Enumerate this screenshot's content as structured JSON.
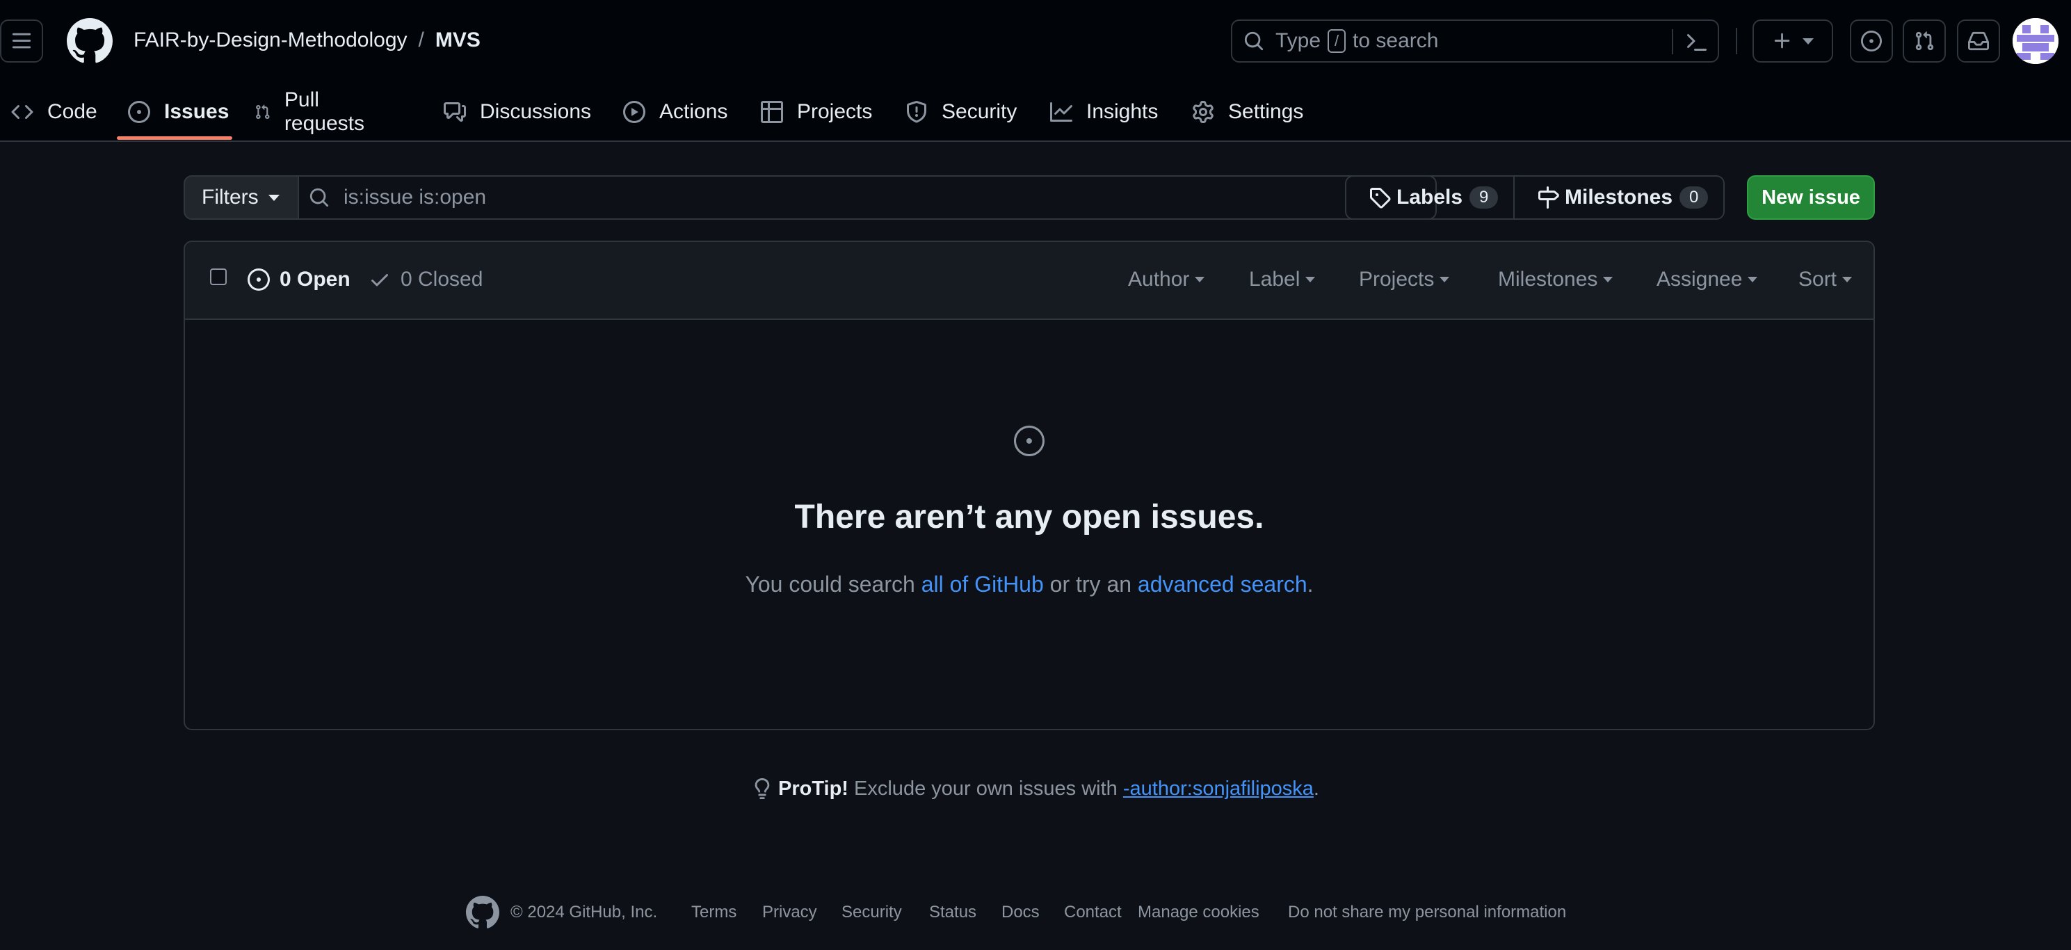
{
  "header": {
    "owner": "FAIR-by-Design-Methodology",
    "separator": "/",
    "repo": "MVS",
    "search_prefix": "Type",
    "search_key": "/",
    "search_suffix": "to search"
  },
  "nav": {
    "tabs": [
      {
        "label": "Code",
        "icon": "code-icon"
      },
      {
        "label": "Issues",
        "icon": "issue-opened-icon",
        "active": true
      },
      {
        "label": "Pull requests",
        "icon": "git-pull-request-icon"
      },
      {
        "label": "Discussions",
        "icon": "comment-discussion-icon"
      },
      {
        "label": "Actions",
        "icon": "play-icon"
      },
      {
        "label": "Projects",
        "icon": "table-icon"
      },
      {
        "label": "Security",
        "icon": "shield-icon"
      },
      {
        "label": "Insights",
        "icon": "graph-icon"
      },
      {
        "label": "Settings",
        "icon": "gear-icon"
      }
    ]
  },
  "subnav": {
    "filters_label": "Filters",
    "query": "is:issue is:open",
    "labels_label": "Labels",
    "labels_count": "9",
    "milestones_label": "Milestones",
    "milestones_count": "0",
    "new_issue_label": "New issue"
  },
  "issues_box": {
    "open_label": "0 Open",
    "closed_label": "0 Closed",
    "sort_menus": [
      "Author",
      "Label",
      "Projects",
      "Milestones",
      "Assignee",
      "Sort"
    ],
    "blank_title": "There aren’t any open issues.",
    "blank_text_1": "You could search ",
    "blank_link_1": "all of GitHub",
    "blank_text_2": " or try an ",
    "blank_link_2": "advanced search",
    "blank_text_3": "."
  },
  "protip": {
    "strong": "ProTip!",
    "text": " Exclude your own issues with ",
    "link": "-author:sonjafiliposka",
    "end": "."
  },
  "footer": {
    "copyright": "© 2024 GitHub, Inc.",
    "links": [
      "Terms",
      "Privacy",
      "Security",
      "Status",
      "Docs",
      "Contact",
      "Manage cookies",
      "Do not share my personal information"
    ]
  },
  "colors": {
    "background": "#0d1117",
    "header": "#010409",
    "accent_underline": "#f78166",
    "primary_button": "#238636",
    "link": "#4493f8"
  }
}
